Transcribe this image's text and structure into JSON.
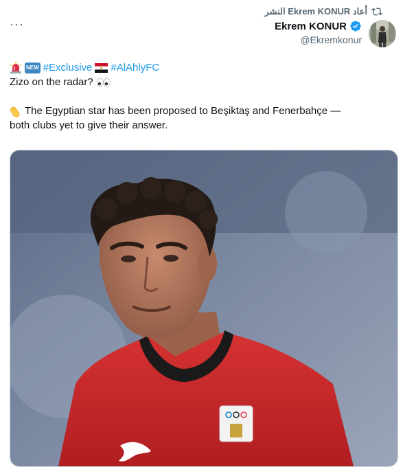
{
  "repost": {
    "text": "أعاد Ekrem KONUR النشر"
  },
  "author": {
    "name": "Ekrem KONUR",
    "handle": "@Ekremkonur"
  },
  "tweet": {
    "hashtag1": "#Exclusive",
    "hashtag2": "#AlAhlyFC",
    "new_badge": "NEW",
    "line2": "Zizo on the radar?",
    "line3": "The Egyptian star has been proposed to Beşiktaş and Fenerbahçe —",
    "line4": "both clubs yet to give their answer."
  },
  "icons": {
    "more": "more-options-icon",
    "repost": "repost-icon",
    "verified": "verified-badge-icon"
  },
  "colors": {
    "link": "#1d9bf0",
    "secondary": "#536471",
    "jersey": "#d52b2b"
  }
}
